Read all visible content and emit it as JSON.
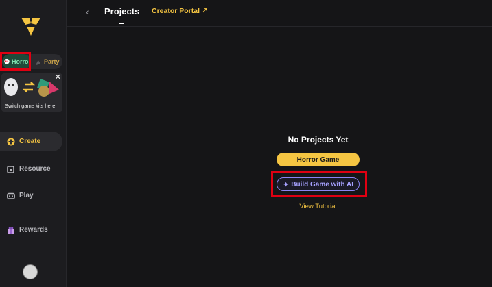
{
  "sidebar": {
    "kit_switch": {
      "horror_label": "Horror",
      "party_label": "Party"
    },
    "tip_card": {
      "text": "Switch game kits here.",
      "close_glyph": "✕"
    },
    "nav": [
      {
        "label": "Create",
        "icon": "gamepad-icon",
        "active": true
      },
      {
        "label": "Resource",
        "icon": "resource-icon",
        "active": false
      },
      {
        "label": "Play",
        "icon": "controller-icon",
        "active": false
      },
      {
        "label": "Rewards",
        "icon": "gift-icon",
        "active": false
      }
    ]
  },
  "topbar": {
    "back_glyph": "‹",
    "title": "Projects",
    "creator_portal": "Creator Portal ↗"
  },
  "empty_state": {
    "title": "No Projects Yet",
    "horror_button": "Horror Game",
    "ai_button": "Build Game with AI",
    "tutorial_link": "View Tutorial"
  },
  "colors": {
    "accent": "#f5c542",
    "ai_accent": "#8a84f3",
    "annotation": "#e00012"
  }
}
